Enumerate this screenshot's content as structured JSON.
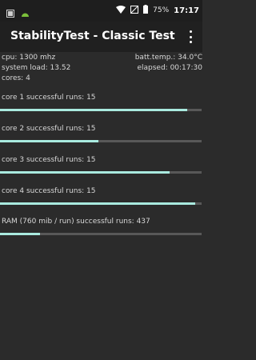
{
  "status_bar": {
    "battery_percent": "75%",
    "time": "17:17",
    "icons": [
      "notification-icon",
      "android-icon",
      "wifi-icon",
      "signal-off-icon",
      "battery-icon"
    ]
  },
  "toolbar": {
    "title": "StabilityTest - Classic Test",
    "menu_icon": "overflow-menu-icon"
  },
  "stats": {
    "cpu": "cpu: 1300 mhz",
    "batt_temp": "batt.temp.: 34.0°C",
    "system_load": "system load: 13.52",
    "elapsed": "elapsed: 00:17:30",
    "cores": "cores: 4"
  },
  "runs": [
    {
      "label": "core 1 successful runs: 15",
      "progress": 0.93
    },
    {
      "label": "core 2 successful runs: 15",
      "progress": 0.49
    },
    {
      "label": "core 3 successful runs: 15",
      "progress": 0.84
    },
    {
      "label": "core 4 successful runs: 15",
      "progress": 0.97
    },
    {
      "label": "RAM (760 mib / run) successful runs: 437",
      "progress": 0.2
    }
  ],
  "colors": {
    "accent": "#a9eadf",
    "track": "#585858",
    "background": "#2b2b2b",
    "toolbar": "#202020"
  }
}
